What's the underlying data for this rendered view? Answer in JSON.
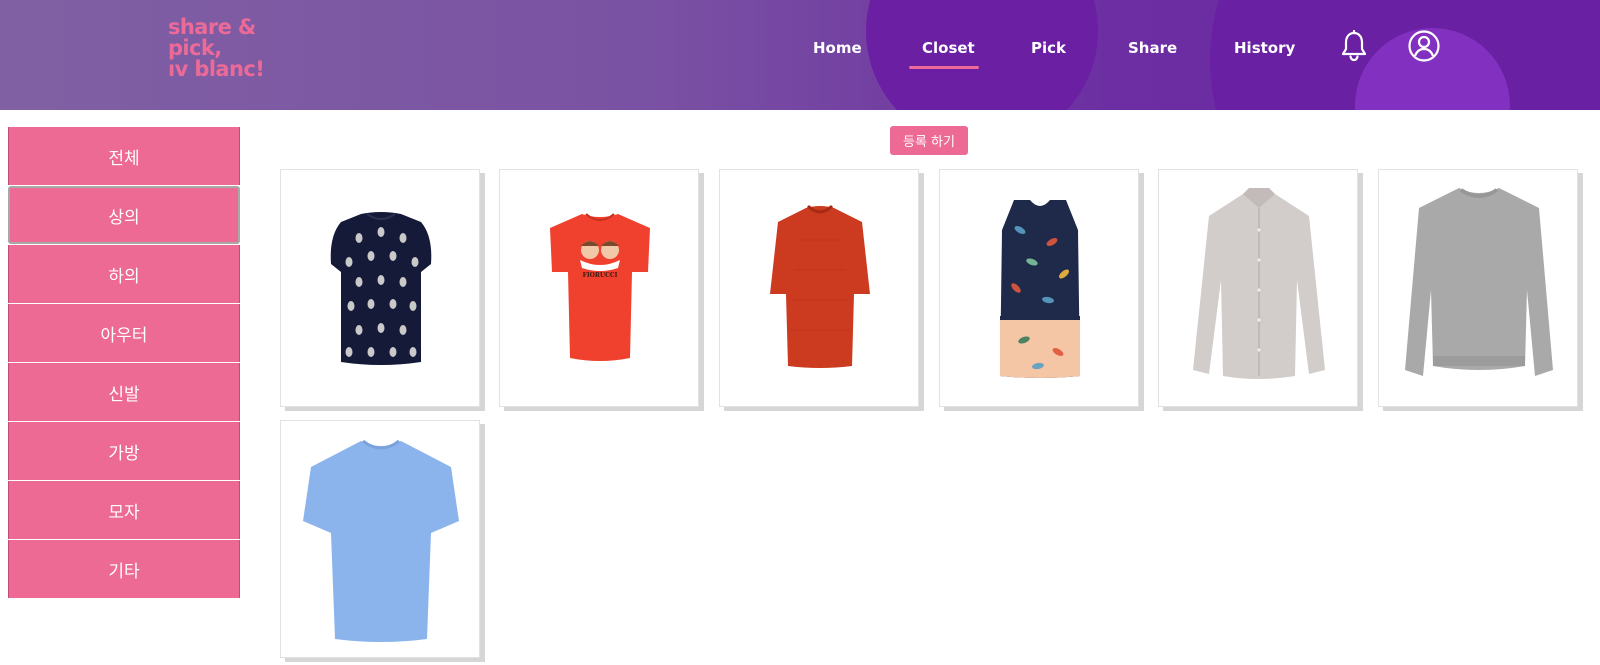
{
  "header": {
    "logo_lines": [
      "share &",
      "pick,",
      "ıv blanc!"
    ],
    "nav": [
      {
        "label": "Home"
      },
      {
        "label": "Closet",
        "active": true
      },
      {
        "label": "Pick"
      },
      {
        "label": "Share"
      },
      {
        "label": "History"
      }
    ],
    "icons": [
      "bell-icon",
      "user-circle-icon"
    ]
  },
  "sidebar": {
    "categories": [
      {
        "label": "전체"
      },
      {
        "label": "상의",
        "selected": true
      },
      {
        "label": "하의"
      },
      {
        "label": "아우터"
      },
      {
        "label": "신발"
      },
      {
        "label": "가방"
      },
      {
        "label": "모자"
      },
      {
        "label": "기타"
      }
    ]
  },
  "main": {
    "register_label": "등록 하기",
    "items": [
      {
        "name": "navy polka-dot top",
        "color": "#141a38"
      },
      {
        "name": "red graphic t-shirt",
        "color": "#f0402e",
        "print": "FIORUCCI"
      },
      {
        "name": "red knit top",
        "color": "#cc3a1f"
      },
      {
        "name": "floral sleeveless blouse",
        "color": "#1f2a4a"
      },
      {
        "name": "light grey button-down shirt",
        "color": "#d2cccb"
      },
      {
        "name": "grey sweatshirt",
        "color": "#a9a9a9"
      },
      {
        "name": "light blue t-shirt",
        "color": "#8cb4ec"
      }
    ]
  },
  "colors": {
    "accent": "#ec6a94",
    "header_purple": "#6a24a4",
    "text_white": "#ffffff"
  }
}
